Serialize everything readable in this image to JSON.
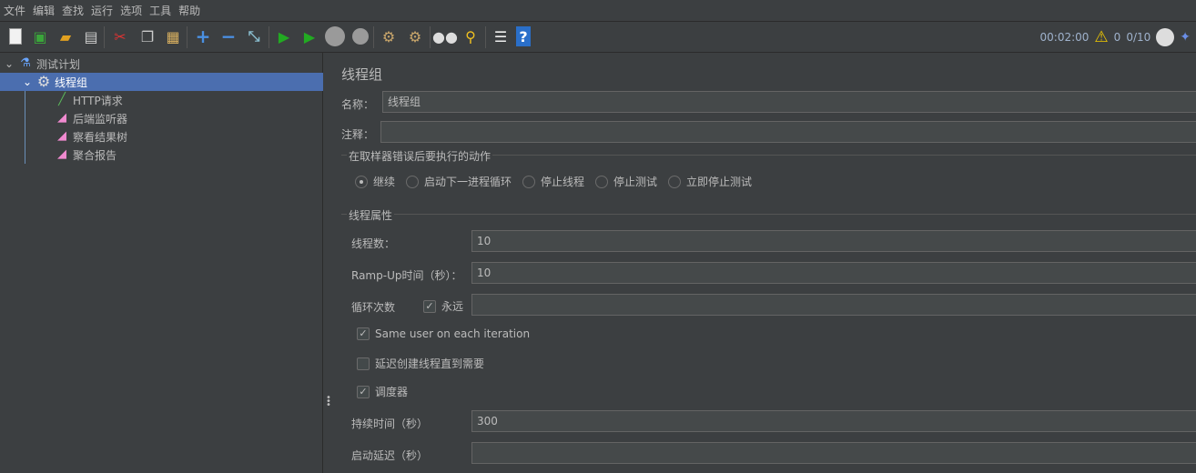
{
  "menu": [
    "文件",
    "编辑",
    "查找",
    "运行",
    "选项",
    "工具",
    "帮助"
  ],
  "toolbar": {
    "icons": [
      "new-icon",
      "templates-icon",
      "open-icon",
      "save-icon",
      "cut-icon",
      "copy-icon",
      "paste-icon",
      "expand-icon",
      "collapse-icon",
      "toggle-icon",
      "start-icon",
      "start-no-pause-icon",
      "stop-icon",
      "shutdown-icon",
      "clear-icon",
      "clear-all-icon",
      "search-icon",
      "reset-search-icon",
      "function-helper-icon",
      "help-icon"
    ]
  },
  "status": {
    "elapsed": "00:02:00",
    "warnings": "0",
    "threads": "0/10"
  },
  "tree": {
    "items": [
      {
        "label": "测试计划",
        "icon": "test-plan-icon"
      },
      {
        "label": "线程组",
        "icon": "thread-group-gear-icon"
      },
      {
        "label": "HTTP请求",
        "icon": "sampler-pipette-icon"
      },
      {
        "label": "后端监听器",
        "icon": "listener-icon"
      },
      {
        "label": "察看结果树",
        "icon": "listener-icon"
      },
      {
        "label": "聚合报告",
        "icon": "listener-icon"
      }
    ]
  },
  "panel": {
    "title": "线程组",
    "name_label": "名称：",
    "name_value": "线程组",
    "comment_label": "注释：",
    "comment_value": "",
    "error_section": "在取样器错误后要执行的动作",
    "error_options": [
      {
        "label": "继续",
        "selected": true
      },
      {
        "label": "启动下一进程循环",
        "selected": false
      },
      {
        "label": "停止线程",
        "selected": false
      },
      {
        "label": "停止测试",
        "selected": false
      },
      {
        "label": "立即停止测试",
        "selected": false
      }
    ],
    "thread_section": "线程属性",
    "threads_label": "线程数：",
    "threads_value": "10",
    "rampup_label": "Ramp-Up时间（秒）：",
    "rampup_value": "10",
    "loop_label": "循环次数",
    "forever_label": "永远",
    "forever_checked": true,
    "loop_value": "",
    "same_user_label": "Same user on each iteration",
    "same_user_checked": true,
    "delay_label": "延迟创建线程直到需要",
    "delay_checked": false,
    "scheduler_label": "调度器",
    "scheduler_checked": true,
    "duration_label": "持续时间（秒）",
    "duration_value": "300",
    "startup_label": "启动延迟（秒）",
    "startup_value": ""
  }
}
